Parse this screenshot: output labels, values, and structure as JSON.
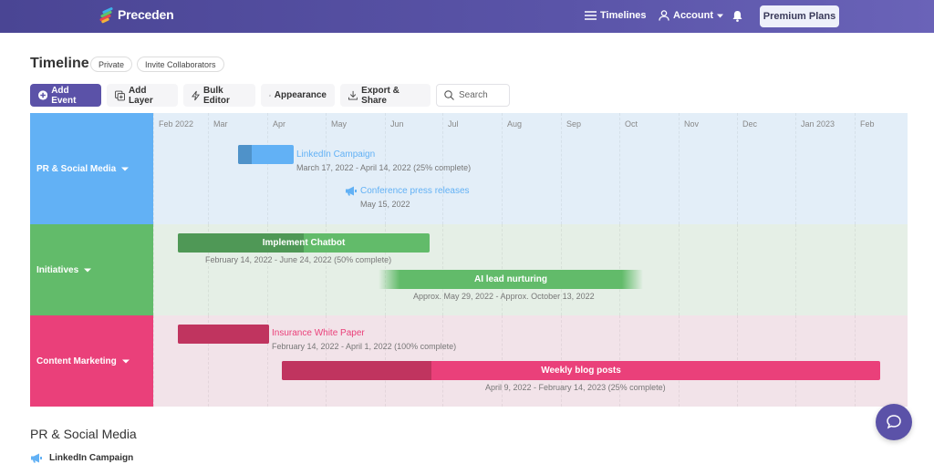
{
  "header": {
    "brand": "Preceden",
    "nav": {
      "timelines": "Timelines",
      "account": "Account"
    },
    "premium_label": "Premium Plans",
    "colors": {
      "bar": "#5049a0"
    }
  },
  "page": {
    "title": "Timeline",
    "privacy_badge": "Private",
    "invite_label": "Invite Collaborators"
  },
  "toolbar": {
    "add_event": "Add Event",
    "add_layer": "Add Layer",
    "bulk_editor": "Bulk Editor",
    "appearance": "Appearance",
    "export_share": "Export & Share",
    "search_placeholder": "Search"
  },
  "timeline": {
    "months": [
      "Feb 2022",
      "Mar",
      "Apr",
      "May",
      "Jun",
      "Jul",
      "Aug",
      "Sep",
      "Oct",
      "Nov",
      "Dec",
      "Jan 2023",
      "Feb"
    ],
    "layers": [
      {
        "name": "PR & Social Media",
        "color": "#62b1f5",
        "bg": "#e3eef8",
        "done_color": "#4f92c9",
        "events": [
          {
            "title": "LinkedIn Campaign",
            "dates": "March 17, 2022 - April 14, 2022 (25% complete)",
            "progress": 0.25,
            "type": "bar-outside-label"
          },
          {
            "title": "Conference press releases",
            "dates": "May 15, 2022",
            "type": "point",
            "icon": "megaphone-icon"
          }
        ]
      },
      {
        "name": "Initiatives",
        "color": "#62bb6a",
        "bg": "#e5efe6",
        "done_color": "#4f9856",
        "events": [
          {
            "title": "Implement Chatbot",
            "dates": "February 14, 2022 - June 24, 2022 (50% complete)",
            "progress": 0.5,
            "type": "bar-inside-label"
          },
          {
            "title": "AI lead nurturing",
            "dates": "Approx. May 29, 2022 - Approx. October 13, 2022",
            "type": "fuzzy-bar"
          }
        ]
      },
      {
        "name": "Content Marketing",
        "color": "#ea407a",
        "bg": "#f2e3e9",
        "done_color": "#c0345f",
        "events": [
          {
            "title": "Insurance White Paper",
            "dates": "February 14, 2022 - April 1, 2022 (100% complete)",
            "progress": 1.0,
            "type": "bar-outside-label"
          },
          {
            "title": "Weekly blog posts",
            "dates": "April 9, 2022 - February 14, 2023 (25% complete)",
            "progress": 0.25,
            "type": "bar-inside-label"
          }
        ]
      }
    ]
  },
  "list": {
    "section_title": "PR & Social Media",
    "first_item": "LinkedIn Campaign"
  }
}
